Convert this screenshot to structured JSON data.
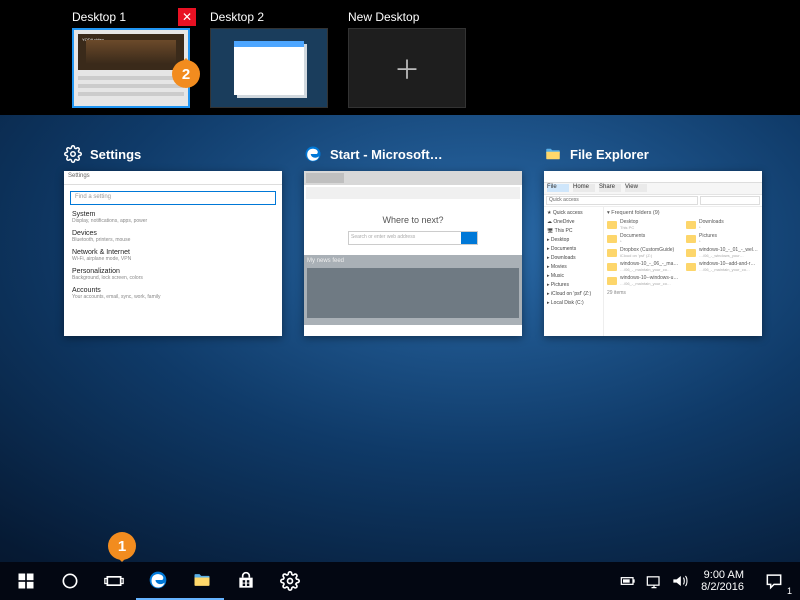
{
  "desktops": [
    {
      "label": "Desktop 1",
      "selected": true,
      "close_visible": true
    },
    {
      "label": "Desktop 2"
    },
    {
      "label": "New Desktop",
      "is_new": true
    }
  ],
  "callouts": {
    "c1": "1",
    "c2": "2"
  },
  "tasks": [
    {
      "title": "Settings",
      "icon": "gear"
    },
    {
      "title": "Start - Microsoft…",
      "icon": "edge"
    },
    {
      "title": "File Explorer",
      "icon": "folder"
    }
  ],
  "settings_window": {
    "title": "Settings",
    "search_placeholder": "Find a setting",
    "items": [
      {
        "title": "System",
        "sub": "Display, notifications, apps, power"
      },
      {
        "title": "Devices",
        "sub": "Bluetooth, printers, mouse"
      },
      {
        "title": "Network & Internet",
        "sub": "Wi-Fi, airplane mode, VPN"
      },
      {
        "title": "Personalization",
        "sub": "Background, lock screen, colors"
      },
      {
        "title": "Accounts",
        "sub": "Your accounts, email, sync, work, family"
      }
    ]
  },
  "edge_window": {
    "tab": "Start",
    "heading": "Where to next?",
    "search_placeholder": "Search or enter web address",
    "news_label": "My news feed"
  },
  "explorer_window": {
    "title": "File Explorer",
    "tabs": [
      "File",
      "Home",
      "Share",
      "View"
    ],
    "path": "Quick access",
    "search_placeholder": "Search Quick access",
    "section": "Frequent folders (9)",
    "nav": [
      "Quick access",
      "OneDrive",
      "This PC",
      "Desktop",
      "Documents",
      "Downloads",
      "Movies",
      "Music",
      "Pictures",
      "iCloud on 'psf' (Z:)",
      "Local Disk (C:)"
    ],
    "items": [
      {
        "name": "Desktop",
        "sub": "This PC"
      },
      {
        "name": "Downloads",
        "sub": "*"
      },
      {
        "name": "Documents",
        "sub": "*"
      },
      {
        "name": "Pictures",
        "sub": "*"
      },
      {
        "name": "Dropbox (CustomGuide)",
        "sub": "iCloud on 'psf' (Z:)"
      },
      {
        "name": "windows-10_-_01_-_wel…",
        "sub": "…/06_-_windows_your…"
      },
      {
        "name": "windows-10_-_06_-_ma…",
        "sub": "…/06_-_maintain_your_co…"
      },
      {
        "name": "windows-10--add-and-r…",
        "sub": "…/06_-_maintain_your_co…"
      },
      {
        "name": "windows-10--windows-u…",
        "sub": "…/06_-_maintain_your_co…"
      }
    ],
    "status": "29 items"
  },
  "taskbar": {
    "time": "9:00 AM",
    "date": "8/2/2016",
    "action_center_count": "1"
  }
}
